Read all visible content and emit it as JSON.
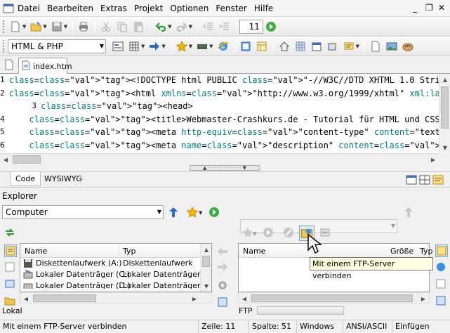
{
  "menu": {
    "items": [
      "Datei",
      "Bearbeiten",
      "Extras",
      "Projekt",
      "Optionen",
      "Fenster",
      "Hilfe"
    ],
    "window_controls": [
      "_",
      "❐",
      "✕"
    ]
  },
  "toolbar1": {
    "number_value": "11"
  },
  "toolbar2": {
    "language_selected": "HTML & PHP"
  },
  "tabs": {
    "doc_tab": "index.htm"
  },
  "editor": {
    "lines": [
      {
        "num": "1",
        "text": "<!DOCTYPE html PUBLIC \"-//W3C//DTD XHTML 1.0 Strict//EN\" \"http://www"
      },
      {
        "num": "2",
        "text": "<html xmlns=\"http://www.w3.org/1999/xhtml\" xml:lang=\"de\" lang=\"de\">"
      },
      {
        "num": "3",
        "text": "<head>"
      },
      {
        "num": "4",
        "text": "    <title>Webmaster-Crashkurs.de - Tutorial für HTML und CSS</title"
      },
      {
        "num": "5",
        "text": "    <meta http-equiv=\"content-type\" content=\"text/html; charset=ISO-"
      },
      {
        "num": "6",
        "text": "    <meta name=\"description\" content=\"\" />"
      }
    ]
  },
  "mode_tabs": {
    "code": "Code",
    "wysiwyg": "WYSIWYG"
  },
  "explorer": {
    "title": "Explorer",
    "location": "Computer",
    "local": {
      "col_name": "Name",
      "col_type": "Typ",
      "rows": [
        {
          "name": "Diskettenlaufwerk (A:)",
          "type": "Diskettenlaufwerk"
        },
        {
          "name": "Lokaler Datenträger (C:)",
          "type": "Lokaler Datenträger"
        },
        {
          "name": "Lokaler Datenträger (D:)",
          "type": "Lokaler Datenträger"
        }
      ],
      "label": "Lokal"
    },
    "ftp": {
      "col_name": "Name",
      "col_size": "Größe",
      "col_type": "Typ",
      "label": "FTP"
    },
    "tooltip": "Mit einem FTP-Server verbinden"
  },
  "status": {
    "message": "Mit einem FTP-Server verbinden",
    "line": "Zeile: 11",
    "column": "Spalte: 51",
    "os": "Windows",
    "encoding": "ANSI/ASCII",
    "mode": "Einfügen"
  }
}
